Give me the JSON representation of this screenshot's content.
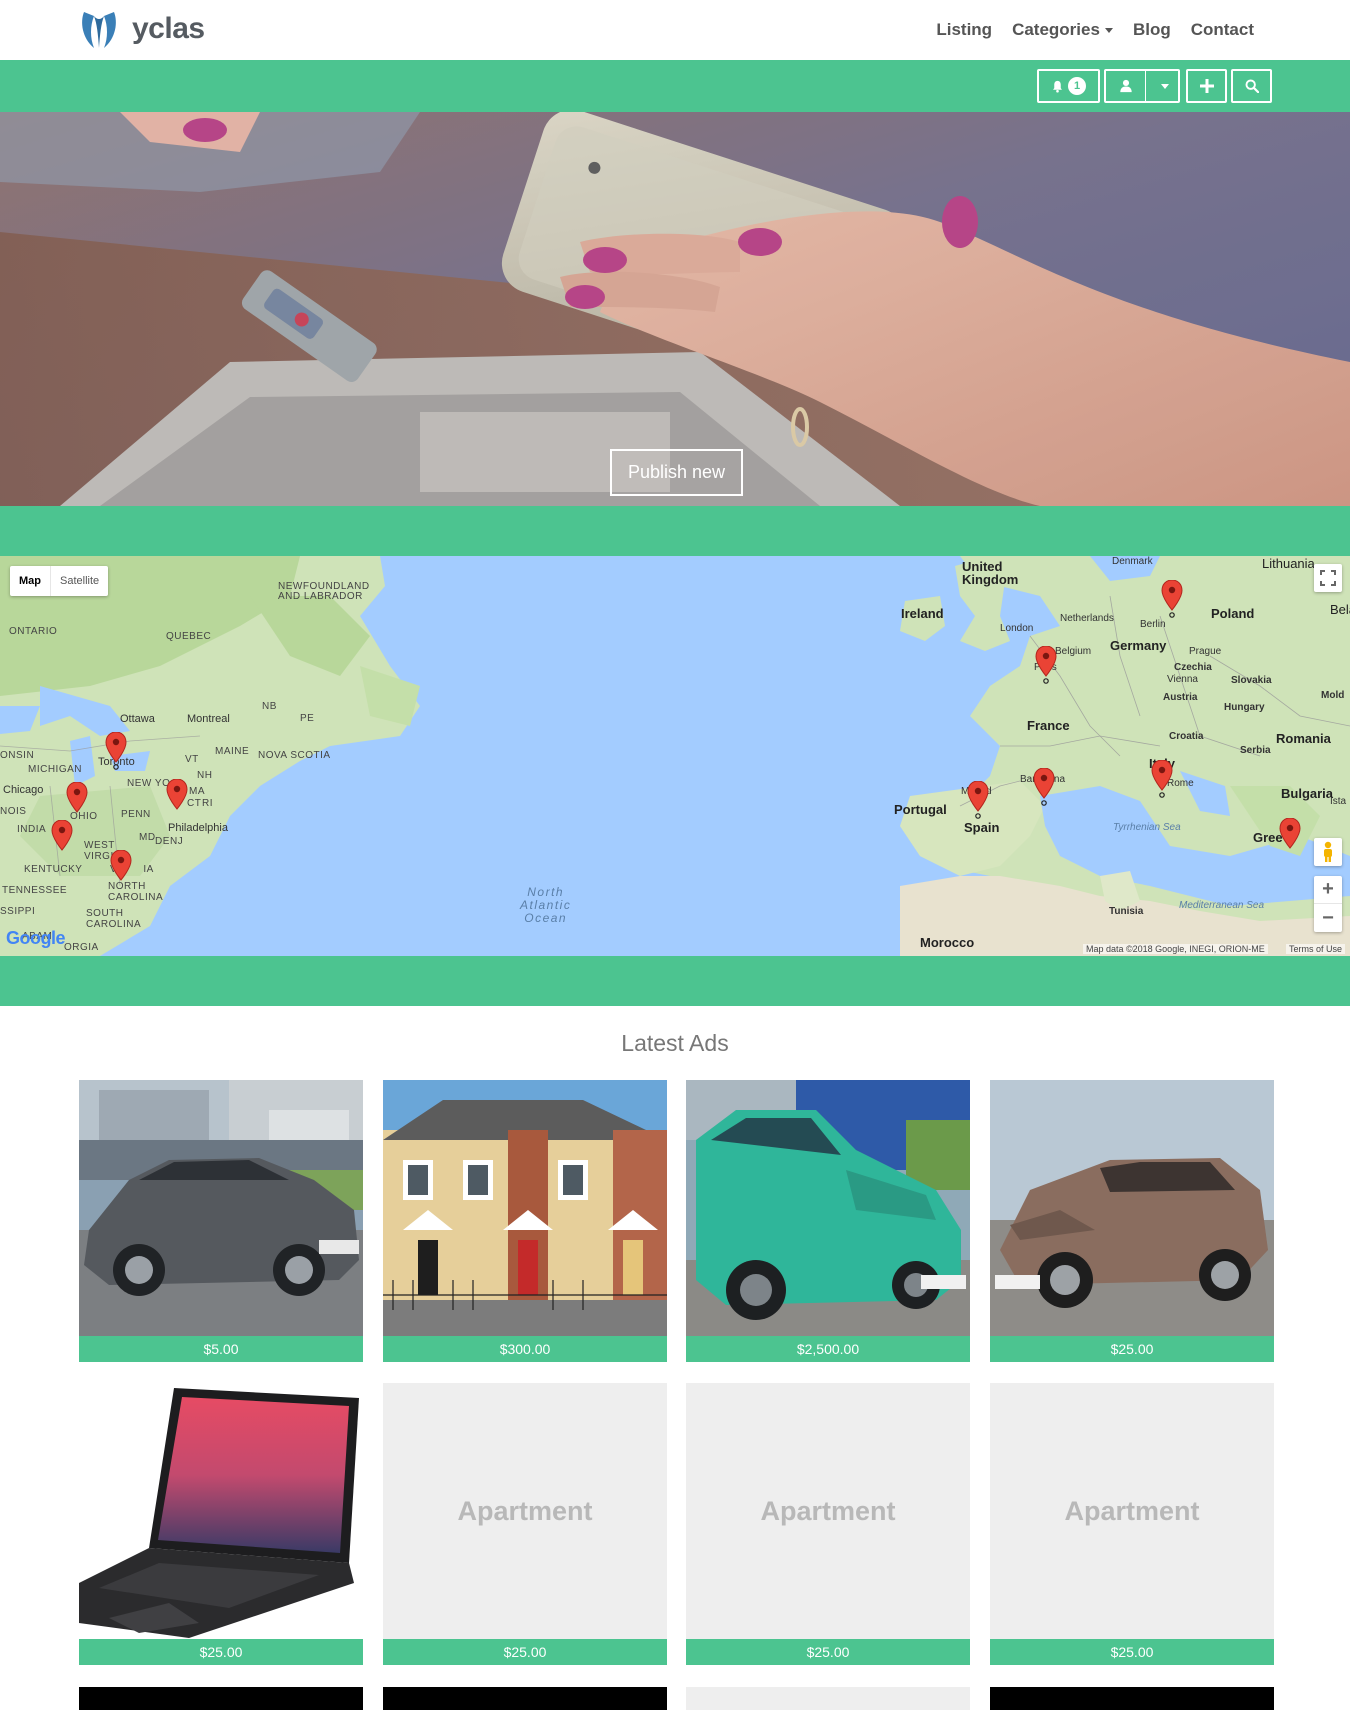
{
  "brand": {
    "name": "yclas",
    "accent": "#4cc490"
  },
  "nav": {
    "items": [
      {
        "label": "Listing"
      },
      {
        "label": "Categories"
      },
      {
        "label": "Blog"
      },
      {
        "label": "Contact"
      }
    ]
  },
  "toolbar": {
    "notifications_icon": "bell-icon",
    "notifications_count": "1",
    "user_icon": "user-icon",
    "dropdown_icon": "caret-down-icon",
    "add_icon": "plus-icon",
    "search_icon": "search-icon"
  },
  "hero": {
    "cta": "Publish new"
  },
  "map": {
    "type_options": [
      "Map",
      "Satellite"
    ],
    "selected_type": "Map",
    "labels": {
      "newfoundland": "NEWFOUNDLAND\nAND LABRADOR",
      "ontario": "ONTARIO",
      "quebec": "QUEBEC",
      "ottawa": "Ottawa",
      "montreal": "Montreal",
      "nb": "NB",
      "pe": "PE",
      "maine": "MAINE",
      "nova_scotia": "NOVA SCOTIA",
      "toronto": "Toronto",
      "vt": "VT",
      "nh": "NH",
      "michigan": "MICHIGAN",
      "wisconsin": "ONSIN",
      "chicago": "Chicago",
      "new_york": "NEW YO",
      "ma": "MA",
      "ct": "CT",
      "ri": "RI",
      "illinois": "NOIS",
      "ohio": "OHIO",
      "penn": "PENN",
      "philadelphia": "Philadelphia",
      "indiana": "INDIA",
      "md": "MD",
      "de": "DE",
      "nj": "NJ",
      "west_virginia": "WEST\nVIRGIN",
      "virginia": "VI       IA",
      "kentucky": "KENTUCKY",
      "tennessee": "TENNESSEE",
      "north_carolina": "NORTH\nCAROLINA",
      "mississippi": "SSIPPI",
      "south_carolina": "SOUTH\nCAROLINA",
      "alabama": "ABAM",
      "georgia": "ORGIA",
      "ocean": "North\nAtlantic\nOcean",
      "uk": "United\nKingdom",
      "ireland": "Ireland",
      "denmark": "Denmark",
      "lithuania": "Lithuania",
      "belarus": "Belar",
      "london": "London",
      "netherlands": "Netherlands",
      "berlin": "Berlin",
      "poland": "Poland",
      "belgium": "Belgium",
      "germany": "Germany",
      "paris": "Paris",
      "prague": "Prague",
      "czechia": "Czechia",
      "vienna": "Vienna",
      "slovakia": "Slovakia",
      "moldova": "Mold",
      "austria": "Austria",
      "hungary": "Hungary",
      "france": "France",
      "romania": "Romania",
      "croatia": "Croatia",
      "serbia": "Serbia",
      "portugal": "Portugal",
      "madrid": "Madrid",
      "barcelona": "Barcelona",
      "italy": "Italy",
      "rome": "Rome",
      "bulgaria": "Bulgaria",
      "istanbul": "Ista",
      "spain": "Spain",
      "tyrrhenian": "Tyrrhenian Sea",
      "greece": "Gree",
      "tunisia": "Tunisia",
      "mediterranean": "Mediterranean Sea",
      "morocco": "Morocco"
    },
    "attribution": "Map data ©2018 Google, INEGI, ORION-ME",
    "terms": "Terms of Use",
    "google": "Google",
    "zoom_in": "+",
    "zoom_out": "−"
  },
  "latest": {
    "title": "Latest Ads",
    "ads": [
      {
        "image": "car-grey-sedan",
        "price": "$5.00"
      },
      {
        "image": "terraced-houses",
        "price": "$300.00"
      },
      {
        "image": "car-green-minivan",
        "price": "$2,500.00"
      },
      {
        "image": "car-bronze-hatchback",
        "price": "$25.00"
      },
      {
        "image": "laptop",
        "price": "$25.00"
      },
      {
        "image": "",
        "placeholder": "Apartment",
        "price": "$25.00"
      },
      {
        "image": "",
        "placeholder": "Apartment",
        "price": "$25.00"
      },
      {
        "image": "",
        "placeholder": "Apartment",
        "price": "$25.00"
      }
    ]
  }
}
